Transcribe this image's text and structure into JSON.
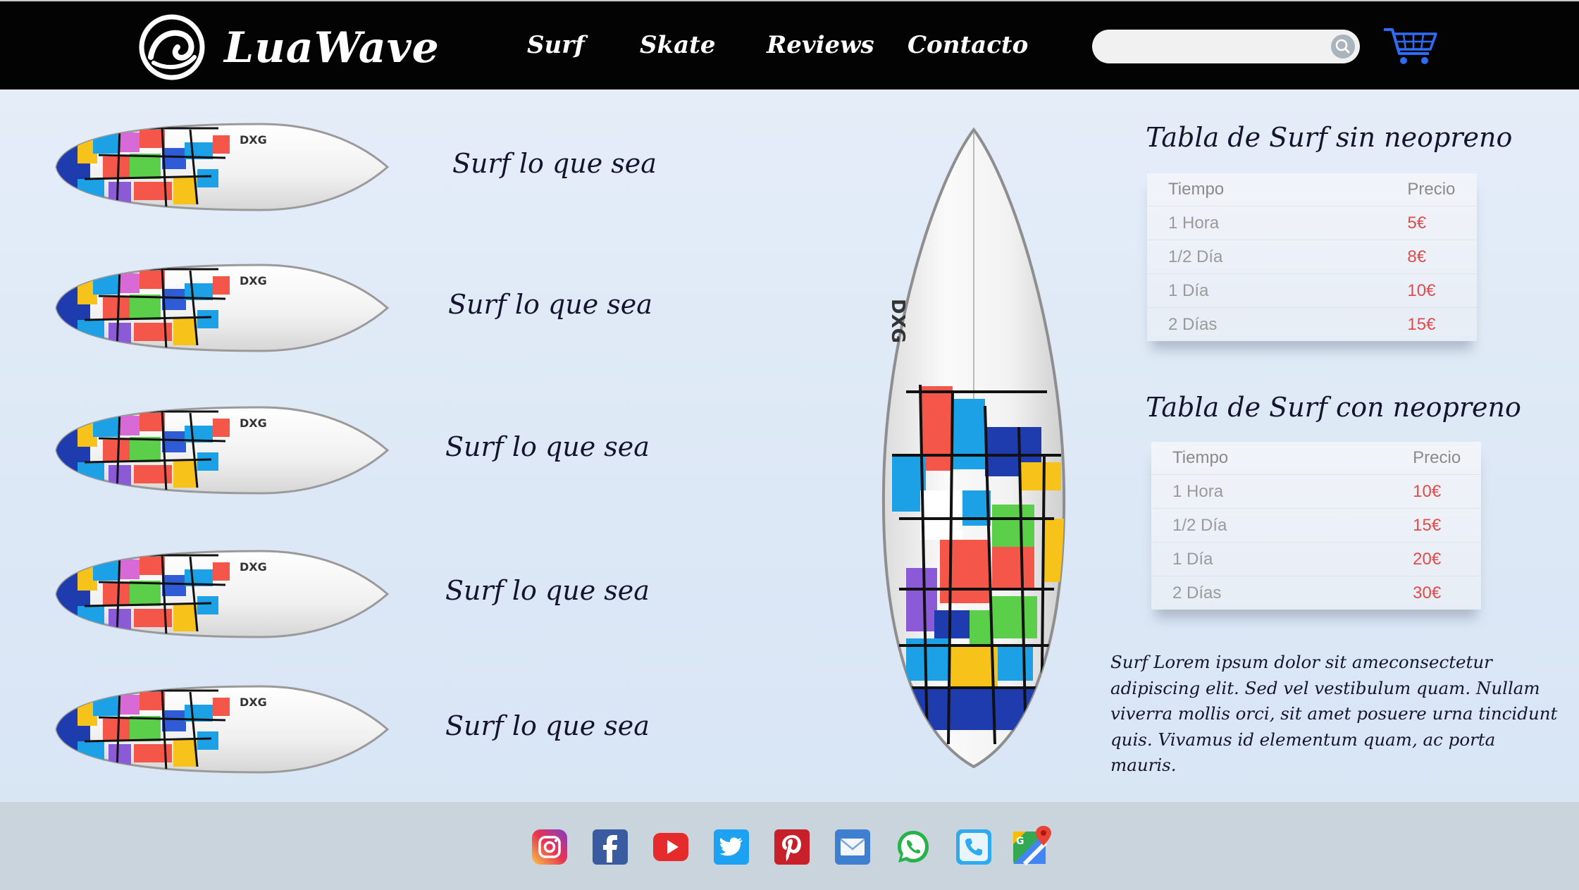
{
  "header": {
    "brand": "LuaWave",
    "nav": [
      {
        "label": "Surf"
      },
      {
        "label": "Skate"
      },
      {
        "label": "Reviews"
      },
      {
        "label": "Contacto"
      }
    ],
    "search_value": "",
    "icons": {
      "logo": "wave-logo-icon",
      "search": "search-icon",
      "cart": "shopping-cart-icon"
    },
    "colors": {
      "bar": "#030303",
      "cart": "#2f6cf5"
    }
  },
  "boards": [
    {
      "label": "Surf lo que sea"
    },
    {
      "label": "Surf lo que sea"
    },
    {
      "label": "Surf lo que sea"
    },
    {
      "label": "Surf lo que sea"
    },
    {
      "label": "Surf lo que sea"
    }
  ],
  "tables": [
    {
      "title": "Tabla de Surf sin neopreno",
      "headers": [
        "Tiempo",
        "Precio"
      ],
      "rows": [
        {
          "time": "1 Hora",
          "price": "5€"
        },
        {
          "time": "1/2 Día",
          "price": "8€"
        },
        {
          "time": "1 Día",
          "price": "10€"
        },
        {
          "time": "2 Días",
          "price": "15€"
        }
      ]
    },
    {
      "title": "Tabla de Surf con neopreno",
      "headers": [
        "Tiempo",
        "Precio"
      ],
      "rows": [
        {
          "time": "1 Hora",
          "price": "10€"
        },
        {
          "time": "1/2 Día",
          "price": "15€"
        },
        {
          "time": "1 Día",
          "price": "20€"
        },
        {
          "time": "2 Días",
          "price": "30€"
        }
      ]
    }
  ],
  "description": "Surf Lorem ipsum dolor sit ameconsectetur adipiscing elit. Sed vel vestibulum quam. Nullam viverra mollis orci, sit amet posuere urna tincidunt quis. Vivamus id elementum quam, ac porta mauris.",
  "footer": {
    "social_icons": [
      "instagram-icon",
      "facebook-icon",
      "youtube-icon",
      "twitter-icon",
      "pinterest-icon",
      "email-icon",
      "whatsapp-icon",
      "phone-icon",
      "google-maps-icon"
    ]
  },
  "colors": {
    "price": "#e04b4b",
    "footer": "#c9d4dc",
    "text": "#14142e"
  }
}
